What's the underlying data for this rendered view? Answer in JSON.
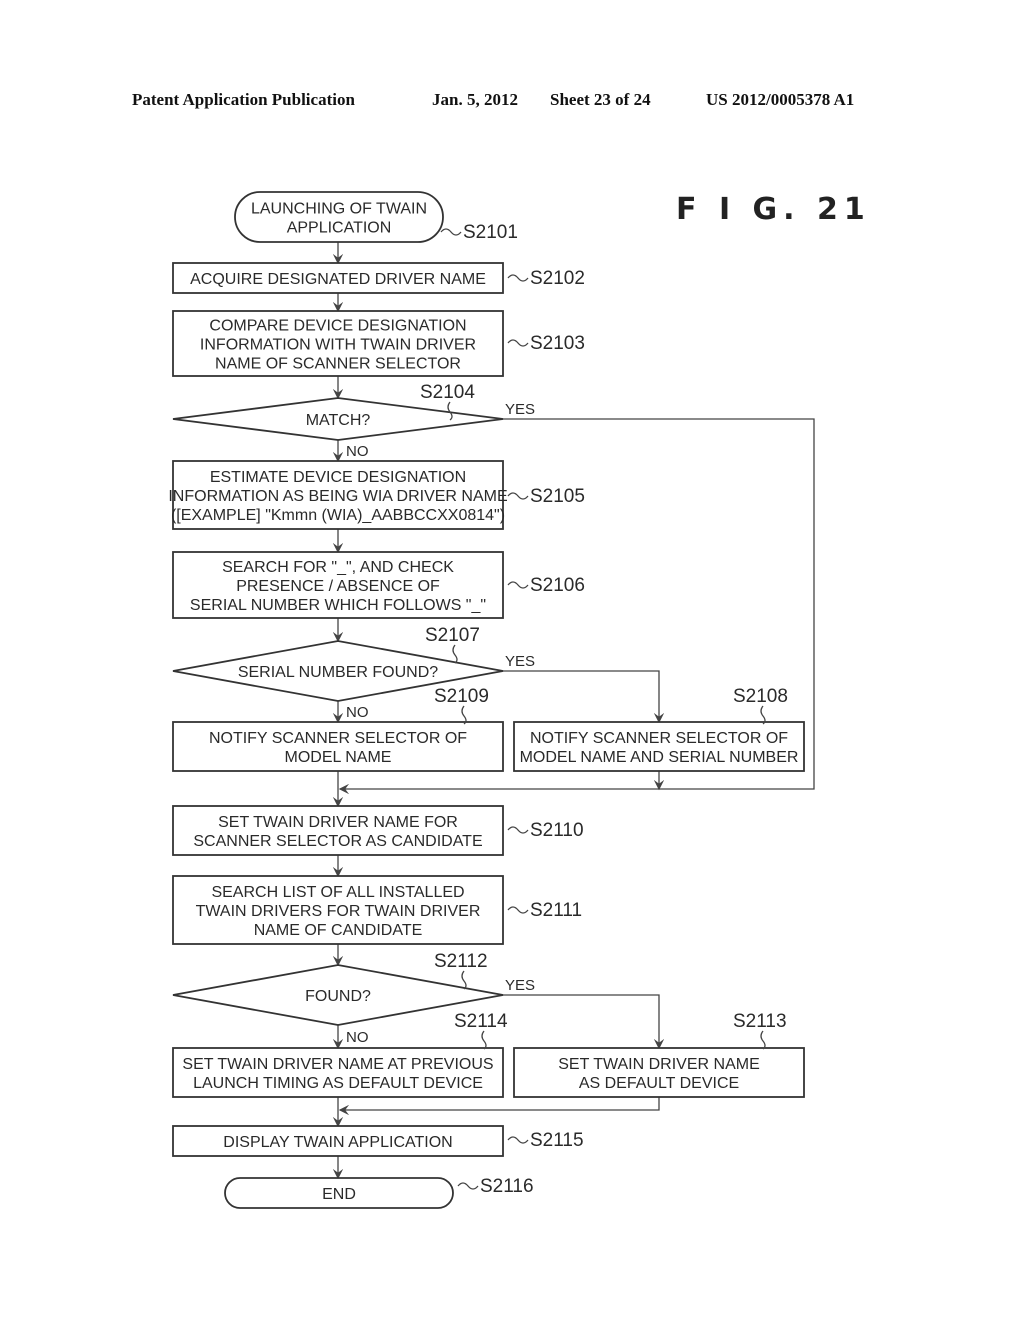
{
  "header": {
    "publication": "Patent Application Publication",
    "date": "Jan. 5, 2012",
    "sheet": "Sheet 23 of 24",
    "number": "US 2012/0005378 A1"
  },
  "figure_label": "F I G. 21",
  "branch_labels": {
    "yes": "YES",
    "no": "NO"
  },
  "steps": {
    "s2101": {
      "id": "S2101",
      "type": "terminal",
      "lines": [
        "LAUNCHING OF TWAIN",
        "APPLICATION"
      ]
    },
    "s2102": {
      "id": "S2102",
      "type": "process",
      "lines": [
        "ACQUIRE DESIGNATED DRIVER NAME"
      ]
    },
    "s2103": {
      "id": "S2103",
      "type": "process",
      "lines": [
        "COMPARE DEVICE DESIGNATION",
        "INFORMATION WITH TWAIN DRIVER",
        "NAME OF SCANNER SELECTOR"
      ]
    },
    "s2104": {
      "id": "S2104",
      "type": "decision",
      "lines": [
        "MATCH?"
      ]
    },
    "s2105": {
      "id": "S2105",
      "type": "process",
      "lines": [
        "ESTIMATE DEVICE DESIGNATION",
        "INFORMATION AS BEING WIA DRIVER NAME",
        "([EXAMPLE] \"Kmmn (WIA)_AABBCCXX0814\")"
      ]
    },
    "s2106": {
      "id": "S2106",
      "type": "process",
      "lines": [
        "SEARCH FOR \"_\", AND CHECK",
        "PRESENCE / ABSENCE OF",
        "SERIAL NUMBER WHICH FOLLOWS \"_\""
      ]
    },
    "s2107": {
      "id": "S2107",
      "type": "decision",
      "lines": [
        "SERIAL NUMBER FOUND?"
      ]
    },
    "s2108": {
      "id": "S2108",
      "type": "process",
      "lines": [
        "NOTIFY SCANNER SELECTOR OF",
        "MODEL NAME AND SERIAL NUMBER"
      ]
    },
    "s2109": {
      "id": "S2109",
      "type": "process",
      "lines": [
        "NOTIFY SCANNER SELECTOR OF",
        "MODEL NAME"
      ]
    },
    "s2110": {
      "id": "S2110",
      "type": "process",
      "lines": [
        "SET TWAIN DRIVER NAME FOR",
        "SCANNER SELECTOR AS CANDIDATE"
      ]
    },
    "s2111": {
      "id": "S2111",
      "type": "process",
      "lines": [
        "SEARCH LIST OF ALL INSTALLED",
        "TWAIN DRIVERS FOR TWAIN DRIVER",
        "NAME OF CANDIDATE"
      ]
    },
    "s2112": {
      "id": "S2112",
      "type": "decision",
      "lines": [
        "FOUND?"
      ]
    },
    "s2113": {
      "id": "S2113",
      "type": "process",
      "lines": [
        "SET TWAIN DRIVER NAME",
        "AS DEFAULT DEVICE"
      ]
    },
    "s2114": {
      "id": "S2114",
      "type": "process",
      "lines": [
        "SET TWAIN DRIVER NAME AT PREVIOUS",
        "LAUNCH TIMING AS DEFAULT DEVICE"
      ]
    },
    "s2115": {
      "id": "S2115",
      "type": "process",
      "lines": [
        "DISPLAY TWAIN APPLICATION"
      ]
    },
    "s2116": {
      "id": "S2116",
      "type": "terminal",
      "lines": [
        "END"
      ]
    }
  }
}
